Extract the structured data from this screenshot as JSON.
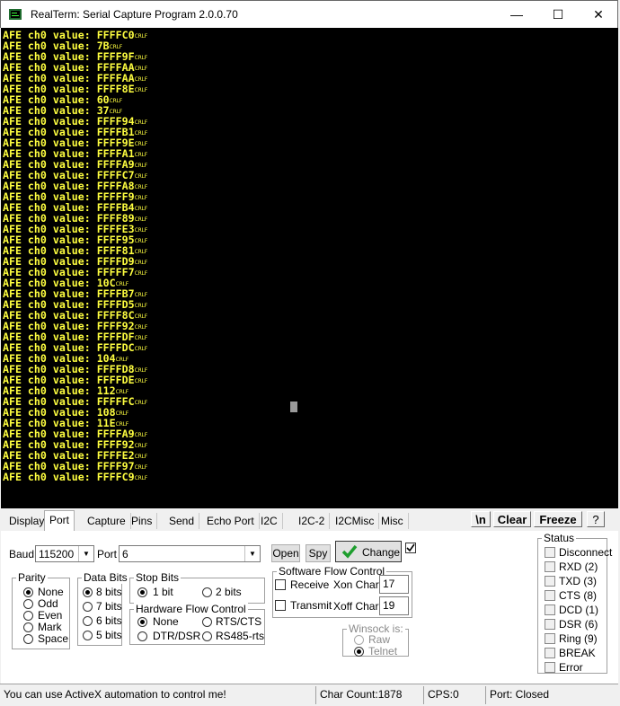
{
  "window": {
    "title": "RealTerm: Serial Capture Program 2.0.0.70",
    "minimize": "—",
    "maximize": "☐",
    "close": "✕"
  },
  "terminal": {
    "lines": [
      {
        "prefix": "AFE ch0 value: ",
        "value": "FFFFC0",
        "crlf": "CRLF"
      },
      {
        "prefix": "AFE ch0 value: ",
        "value": "7B",
        "crlf": "CRLF"
      },
      {
        "prefix": "AFE ch0 value: ",
        "value": "FFFF9F",
        "crlf": "CRLF"
      },
      {
        "prefix": "AFE ch0 value: ",
        "value": "FFFFAA",
        "crlf": "CRLF"
      },
      {
        "prefix": "AFE ch0 value: ",
        "value": "FFFFAA",
        "crlf": "CRLF"
      },
      {
        "prefix": "AFE ch0 value: ",
        "value": "FFFF8E",
        "crlf": "CRLF"
      },
      {
        "prefix": "AFE ch0 value: ",
        "value": "60",
        "crlf": "CRLF"
      },
      {
        "prefix": "AFE ch0 value: ",
        "value": "37",
        "crlf": "CRLF"
      },
      {
        "prefix": "AFE ch0 value: ",
        "value": "FFFF94",
        "crlf": "CRLF"
      },
      {
        "prefix": "AFE ch0 value: ",
        "value": "FFFFB1",
        "crlf": "CRLF"
      },
      {
        "prefix": "AFE ch0 value: ",
        "value": "FFFF9E",
        "crlf": "CRLF"
      },
      {
        "prefix": "AFE ch0 value: ",
        "value": "FFFFA1",
        "crlf": "CRLF"
      },
      {
        "prefix": "AFE ch0 value: ",
        "value": "FFFFA9",
        "crlf": "CRLF"
      },
      {
        "prefix": "AFE ch0 value: ",
        "value": "FFFFC7",
        "crlf": "CRLF"
      },
      {
        "prefix": "AFE ch0 value: ",
        "value": "FFFFA8",
        "crlf": "CRLF"
      },
      {
        "prefix": "AFE ch0 value: ",
        "value": "FFFFF9",
        "crlf": "CRLF"
      },
      {
        "prefix": "AFE ch0 value: ",
        "value": "FFFFB4",
        "crlf": "CRLF"
      },
      {
        "prefix": "AFE ch0 value: ",
        "value": "FFFF89",
        "crlf": "CRLF"
      },
      {
        "prefix": "AFE ch0 value: ",
        "value": "FFFFE3",
        "crlf": "CRLF"
      },
      {
        "prefix": "AFE ch0 value: ",
        "value": "FFFF95",
        "crlf": "CRLF"
      },
      {
        "prefix": "AFE ch0 value: ",
        "value": "FFFF81",
        "crlf": "CRLF"
      },
      {
        "prefix": "AFE ch0 value: ",
        "value": "FFFFD9",
        "crlf": "CRLF"
      },
      {
        "prefix": "AFE ch0 value: ",
        "value": "FFFFF7",
        "crlf": "CRLF"
      },
      {
        "prefix": "AFE ch0 value: ",
        "value": "10C",
        "crlf": "CRLF"
      },
      {
        "prefix": "AFE ch0 value: ",
        "value": "FFFFB7",
        "crlf": "CRLF"
      },
      {
        "prefix": "AFE ch0 value: ",
        "value": "FFFFD5",
        "crlf": "CRLF"
      },
      {
        "prefix": "AFE ch0 value: ",
        "value": "FFFF8C",
        "crlf": "CRLF"
      },
      {
        "prefix": "AFE ch0 value: ",
        "value": "FFFF92",
        "crlf": "CRLF"
      },
      {
        "prefix": "AFE ch0 value: ",
        "value": "FFFFDF",
        "crlf": "CRLF"
      },
      {
        "prefix": "AFE ch0 value: ",
        "value": "FFFFDC",
        "crlf": "CRLF"
      },
      {
        "prefix": "AFE ch0 value: ",
        "value": "104",
        "crlf": "CRLF"
      },
      {
        "prefix": "AFE ch0 value: ",
        "value": "FFFFD8",
        "crlf": "CRLF"
      },
      {
        "prefix": "AFE ch0 value: ",
        "value": "FFFFDE",
        "crlf": "CRLF"
      },
      {
        "prefix": "AFE ch0 value: ",
        "value": "112",
        "crlf": "CRLF"
      },
      {
        "prefix": "AFE ch0 value: ",
        "value": "FFFFFC",
        "crlf": "CRLF"
      },
      {
        "prefix": "AFE ch0 value: ",
        "value": "108",
        "crlf": "CRLF"
      },
      {
        "prefix": "AFE ch0 value: ",
        "value": "11E",
        "crlf": "CRLF"
      },
      {
        "prefix": "AFE ch0 value: ",
        "value": "FFFFA9",
        "crlf": "CRLF"
      },
      {
        "prefix": "AFE ch0 value: ",
        "value": "FFFF92",
        "crlf": "CRLF"
      },
      {
        "prefix": "AFE ch0 value: ",
        "value": "FFFFE2",
        "crlf": "CRLF"
      },
      {
        "prefix": "AFE ch0 value: ",
        "value": "FFFF97",
        "crlf": "CRLF"
      },
      {
        "prefix": "AFE ch0 value: ",
        "value": "FFFFC9",
        "crlf": "CRLF"
      }
    ],
    "colors": {
      "background": "#000000",
      "text": "#ffff40"
    }
  },
  "tabs": [
    {
      "label": "Display"
    },
    {
      "label": "Port"
    },
    {
      "label": "Capture"
    },
    {
      "label": "Pins"
    },
    {
      "label": "Send"
    },
    {
      "label": "Echo Port"
    },
    {
      "label": "I2C"
    },
    {
      "label": "I2C-2"
    },
    {
      "label": "I2CMisc"
    },
    {
      "label": "Misc"
    }
  ],
  "active_tab": "Port",
  "tab_buttons": {
    "newline": "\\n",
    "clear": "Clear",
    "freeze": "Freeze",
    "help": "?"
  },
  "port": {
    "baud_label": "Baud",
    "baud_value": "115200",
    "port_label": "Port",
    "port_value": "6",
    "open_label": "Open",
    "spy_label": "Spy",
    "change_label": "Change",
    "change_checked": true,
    "parity": {
      "title": "Parity",
      "options": [
        "None",
        "Odd",
        "Even",
        "Mark",
        "Space"
      ],
      "selected": "None"
    },
    "data_bits": {
      "title": "Data Bits",
      "options": [
        "8 bits",
        "7 bits",
        "6 bits",
        "5 bits"
      ],
      "selected": "8 bits"
    },
    "stop_bits": {
      "title": "Stop Bits",
      "options": [
        "1 bit",
        "2 bits"
      ],
      "selected": "1 bit"
    },
    "hw_flow": {
      "title": "Hardware Flow Control",
      "options": [
        "None",
        "RTS/CTS",
        "DTR/DSR",
        "RS485-rts"
      ],
      "selected": "None"
    },
    "sw_flow": {
      "title": "Software Flow Control",
      "receive_label": "Receive",
      "transmit_label": "Transmit",
      "xon_label": "Xon Char:",
      "xon_value": "17",
      "xoff_label": "Xoff Char:",
      "xoff_value": "19"
    },
    "winsock": {
      "title": "Winsock is:",
      "options": [
        "Raw",
        "Telnet"
      ],
      "selected": "Telnet"
    }
  },
  "status_panel": {
    "title": "Status",
    "items": [
      "Disconnect",
      "RXD (2)",
      "TXD (3)",
      "CTS (8)",
      "DCD (1)",
      "DSR (6)",
      "Ring (9)",
      "BREAK",
      "Error"
    ]
  },
  "statusbar": {
    "message": "You can use ActiveX automation to control me!",
    "char_count": "Char Count:1878",
    "cps": "CPS:0",
    "port_status": "Port: Closed"
  }
}
